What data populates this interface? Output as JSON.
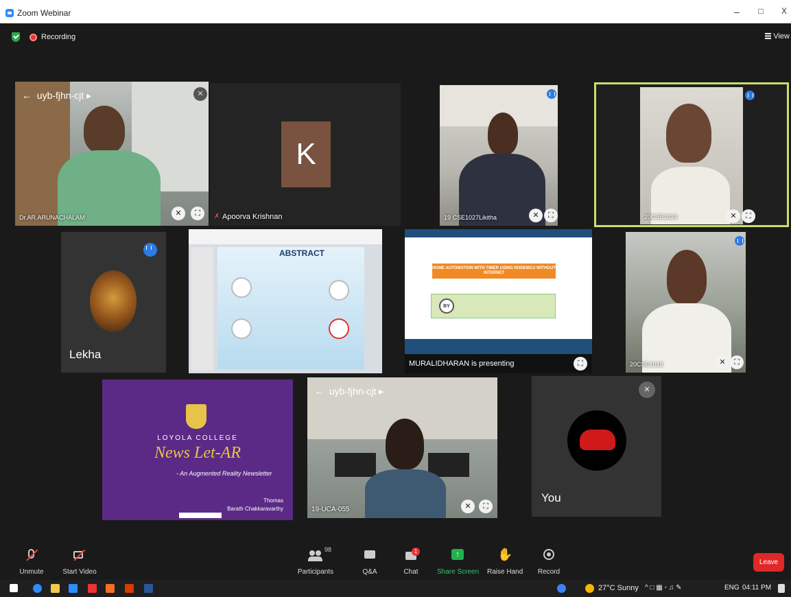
{
  "window": {
    "title": "Zoom Webinar",
    "minimize": "–",
    "maximize": "□",
    "close": "X"
  },
  "status": {
    "recording_label": "Recording",
    "view_label": "View"
  },
  "tiles": {
    "t1": {
      "top_label": "uyb-fjhn-cjt",
      "name": "Dr.AR.ARUNACHALAM"
    },
    "t2": {
      "initial": "K",
      "name": "Apoorva Krishnan"
    },
    "t3": {
      "name": "19 CSE1027Likitha"
    },
    "t4": {
      "name": "20CSE1024"
    },
    "t5": {
      "name": "Lekha"
    },
    "t6": {
      "slide_title": "ABSTRACT"
    },
    "t7": {
      "slide_title": "HOME AUTOMATION WITH TIMER USING NODEMCU WITHOUT INTERNET",
      "by_label": "BY",
      "presenting_label": "MURALIDHARAN is presenting"
    },
    "t8": {
      "name": "20CSE1018"
    },
    "t9": {
      "college": "LOYOLA COLLEGE",
      "title": "News Let-AR",
      "subtitle": "- An Augmented Reality Newsletter",
      "author1": "Thomas",
      "author2": "Barath Chakkaravarthy"
    },
    "t10": {
      "top_label": "uyb-fjhn-cjt",
      "name": "19-UCA-055"
    },
    "t11": {
      "name": "You"
    }
  },
  "toolbar": {
    "unmute": "Unmute",
    "start_video": "Start Video",
    "participants": "Participants",
    "participants_count": "98",
    "qa": "Q&A",
    "chat": "Chat",
    "chat_badge": "1",
    "share_screen": "Share Screen",
    "raise_hand": "Raise Hand",
    "record": "Record",
    "leave": "Leave"
  },
  "taskbar": {
    "weather": "27°C  Sunny",
    "lang": "ENG",
    "time": "04:11 PM"
  },
  "colors": {
    "accent": "#2d8cff",
    "leave": "#e02828",
    "share": "#23b14d",
    "active_speaker": "#c7e06b"
  }
}
